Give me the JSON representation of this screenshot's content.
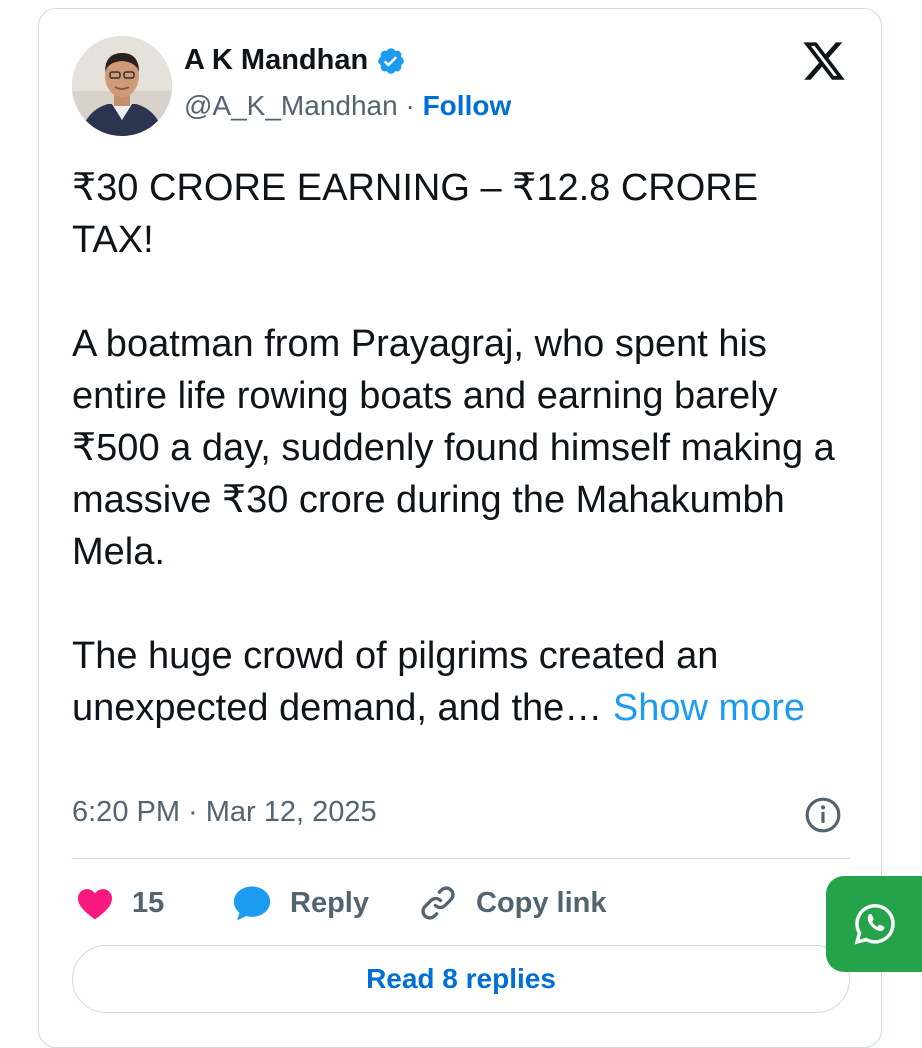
{
  "author": {
    "name": "A K Mandhan",
    "handle": "@A_K_Mandhan",
    "separator": "·",
    "follow_label": "Follow",
    "verified": true,
    "avatar_icon": "person-photo"
  },
  "brand_icon": "x-logo-icon",
  "tweet": {
    "headline": "₹30 CRORE EARNING – ₹12.8 CRORE TAX!",
    "paragraph_1": "A boatman from Prayagraj, who spent his entire life rowing boats and earning barely ₹500 a day, suddenly found himself making a massive ₹30 crore during the Mahakumbh Mela.",
    "paragraph_2": "The huge crowd of pilgrims created an unexpected demand, and the…",
    "show_more_label": "Show more"
  },
  "timestamp": "6:20 PM · Mar 12, 2025",
  "actions": {
    "like_count": "15",
    "reply_label": "Reply",
    "copy_link_label": "Copy link"
  },
  "read_replies_label": "Read 8 replies",
  "colors": {
    "link_blue": "#006fd6",
    "show_more_blue": "#1d9bf0",
    "like_pink": "#f91880",
    "reply_blue": "#1d9bf0",
    "whatsapp_green": "#25a34a",
    "border": "#cfd9de",
    "secondary_text": "#536471"
  }
}
